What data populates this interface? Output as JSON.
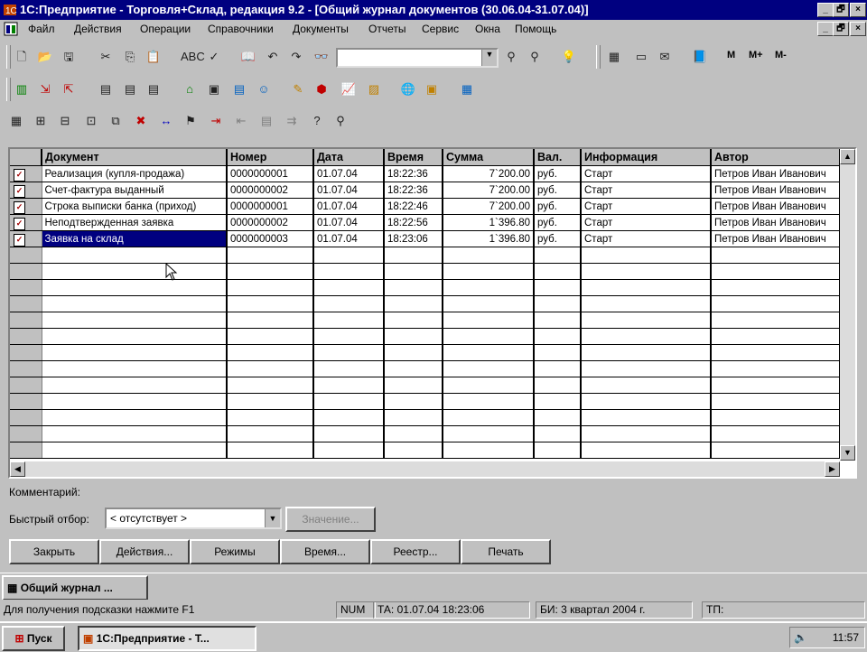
{
  "window": {
    "title": "1С:Предприятие - Торговля+Склад, редакция 9.2 - [Общий журнал документов (30.06.04-31.07.04)]",
    "minimize": "_",
    "restore": "🗗",
    "close": "×"
  },
  "menu": [
    "Файл",
    "Действия",
    "Операции",
    "Справочники",
    "Документы",
    "Отчеты",
    "Сервис",
    "Окна",
    "Помощь"
  ],
  "toolbar": {
    "memory_buttons": [
      "M",
      "M+",
      "M-"
    ],
    "search_value": ""
  },
  "grid": {
    "columns": [
      "Документ",
      "Номер",
      "Дата",
      "Время",
      "Сумма",
      "Вал.",
      "Информация",
      "Автор"
    ],
    "rows": [
      [
        "Реализация (купля-продажа)",
        "0000000001",
        "01.07.04",
        "18:22:36",
        "7`200.00",
        "руб.",
        "Старт",
        "Петров Иван Иванович"
      ],
      [
        "Счет-фактура выданный",
        "0000000002",
        "01.07.04",
        "18:22:36",
        "7`200.00",
        "руб.",
        "Старт",
        "Петров Иван Иванович"
      ],
      [
        "Строка выписки банка (приход)",
        "0000000001",
        "01.07.04",
        "18:22:46",
        "7`200.00",
        "руб.",
        "Старт",
        "Петров Иван Иванович"
      ],
      [
        "Неподтвержденная заявка",
        "0000000002",
        "01.07.04",
        "18:22:56",
        "1`396.80",
        "руб.",
        "Старт",
        "Петров Иван Иванович"
      ],
      [
        "Заявка на склад",
        "0000000003",
        "01.07.04",
        "18:23:06",
        "1`396.80",
        "руб.",
        "Старт",
        "Петров Иван Иванович"
      ]
    ]
  },
  "comment_label": "Комментарий:",
  "filter": {
    "label": "Быстрый отбор:",
    "value": "< отсутствует >",
    "value_button": "Значение..."
  },
  "buttons": [
    "Закрыть",
    "Действия...",
    "Режимы",
    "Время...",
    "Реестр...",
    "Печать"
  ],
  "doc_tab": "Общий журнал ...",
  "status": {
    "hint": "Для получения подсказки нажмите F1",
    "num": "NUM",
    "ta": "ТА: 01.07.04  18:23:06",
    "bi": "БИ: 3 квартал 2004 г.",
    "tp": "ТП:"
  },
  "taskbar": {
    "start": "Пуск",
    "task": "1С:Предприятие - Т...",
    "clock": "11:57"
  }
}
